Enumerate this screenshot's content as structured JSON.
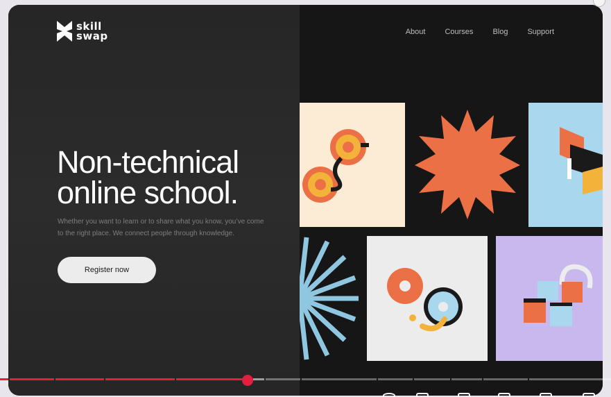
{
  "brand": {
    "logo_text": "skill\nswap"
  },
  "nav": {
    "items": [
      "About",
      "Courses",
      "Blog",
      "Support"
    ]
  },
  "hero": {
    "headline": "Non-technical online school.",
    "subtext": "Whether you want to learn or to share what you know, you’ve come to the right place. We connect people through knowledge.",
    "cta_label": "Register now"
  },
  "colors": {
    "orange": "#ec7046",
    "cream": "#fcebd5",
    "light_blue": "#a9d8ee",
    "lavender": "#c9b8ee",
    "yellow": "#f3b33a",
    "accent_red": "#e41e3f"
  },
  "video_player": {
    "progress_fraction": 0.41
  }
}
